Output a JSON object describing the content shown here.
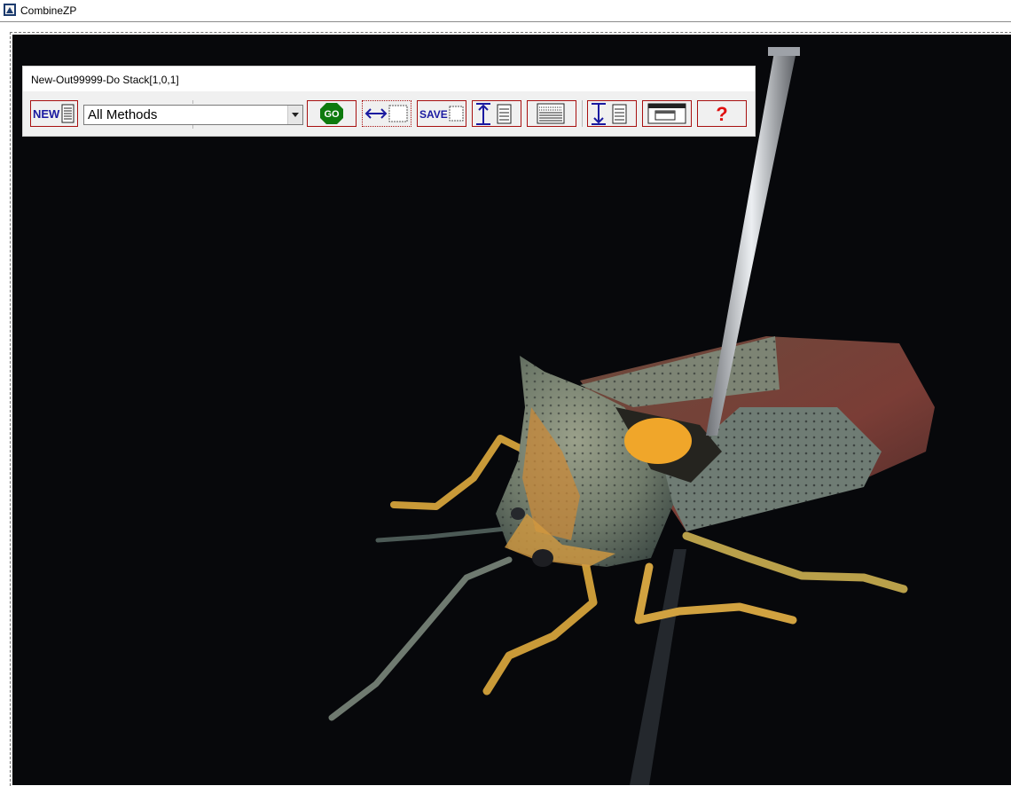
{
  "window": {
    "title": "CombineZP"
  },
  "toolbar": {
    "title": "New-Out99999-Do Stack[1,0,1]",
    "new_label": "NEW",
    "method_select": {
      "selected": "All Methods"
    },
    "go_label": "GO",
    "save_label": "SAVE",
    "help_label": "?"
  },
  "colors": {
    "button_border": "#a81010",
    "go_fill": "#0e7a0e",
    "icon_blue": "#1a1aa0",
    "help_red": "#e01010",
    "image_background": "#07080b"
  },
  "icons": {
    "app": "combinezp-app-icon",
    "new": "page-icon",
    "go": "octagon-go-icon",
    "size": "horizontal-resize-icon",
    "save": "save-rectangle-icon",
    "top_frame": "arrow-up-page-icon",
    "frames": "frames-list-icon",
    "bottom_frame": "arrow-down-page-icon",
    "window": "window-icon",
    "help": "question-mark-icon"
  }
}
